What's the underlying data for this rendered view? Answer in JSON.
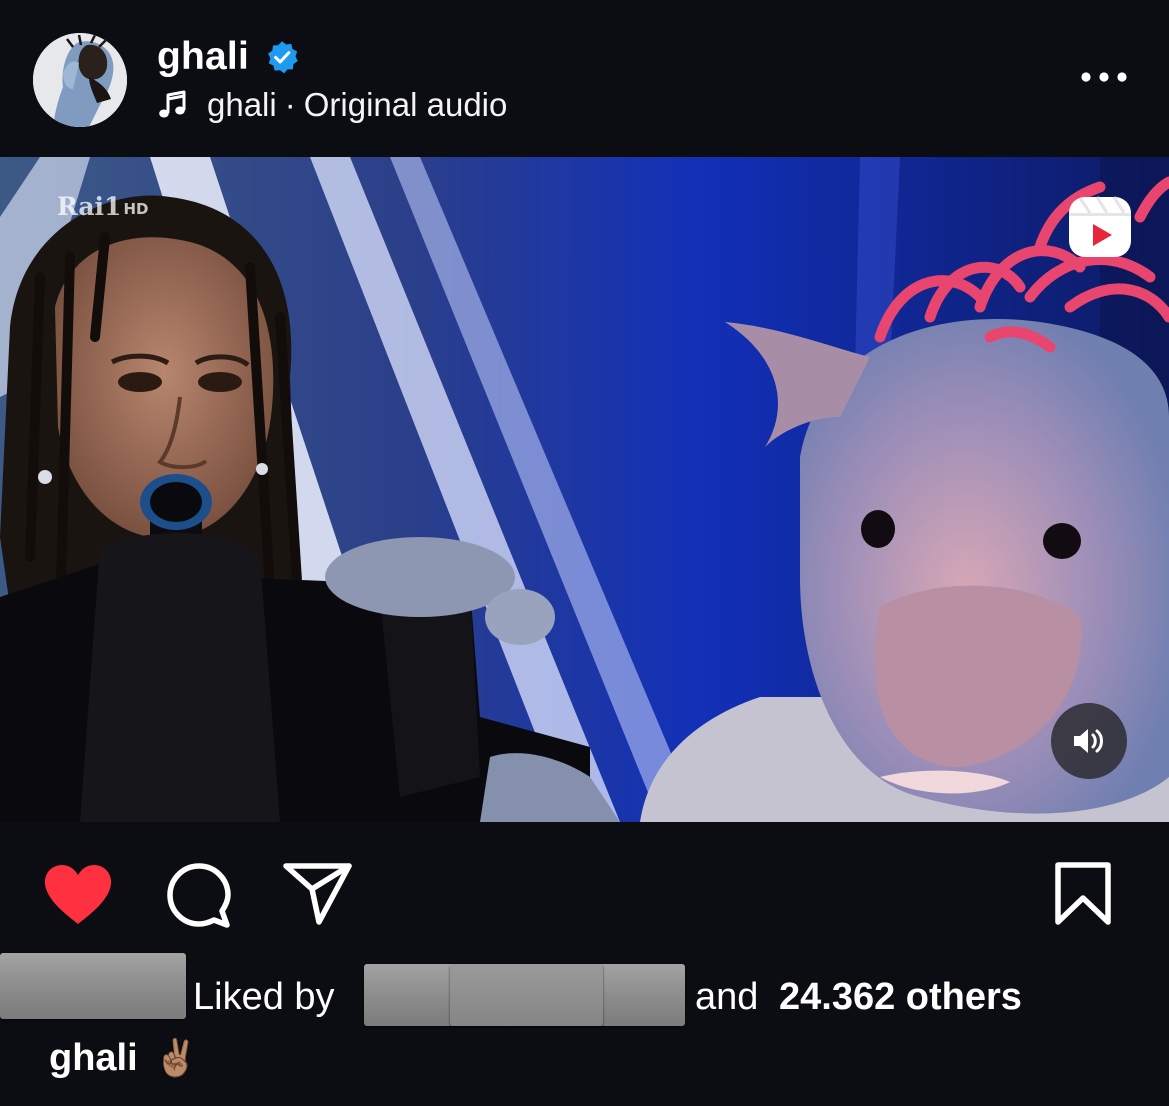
{
  "post": {
    "username": "ghali",
    "verified": true,
    "audio": {
      "artist": "ghali",
      "separator": "·",
      "label": "Original audio",
      "icon": "music-note-icon"
    },
    "menu_icon": "more-options-icon"
  },
  "media": {
    "broadcaster_logo": "Rai",
    "broadcaster_channel": "1",
    "broadcaster_quality": "HD",
    "reels_icon": "reels-icon",
    "sound_icon": "speaker-icon"
  },
  "actions": {
    "liked": true,
    "icons": [
      "heart-filled-icon",
      "comment-icon",
      "share-icon",
      "bookmark-icon"
    ]
  },
  "likes": {
    "prefix": "Liked by",
    "conjunction": "and",
    "count": "24.362 others"
  },
  "caption": {
    "username": "ghali",
    "text": "✌🏽"
  },
  "colors": {
    "background": "#0b0d12",
    "verified_blue": "#1d9bf0",
    "like_red": "#ff3040",
    "blur_gray": "#8f8f8f"
  }
}
